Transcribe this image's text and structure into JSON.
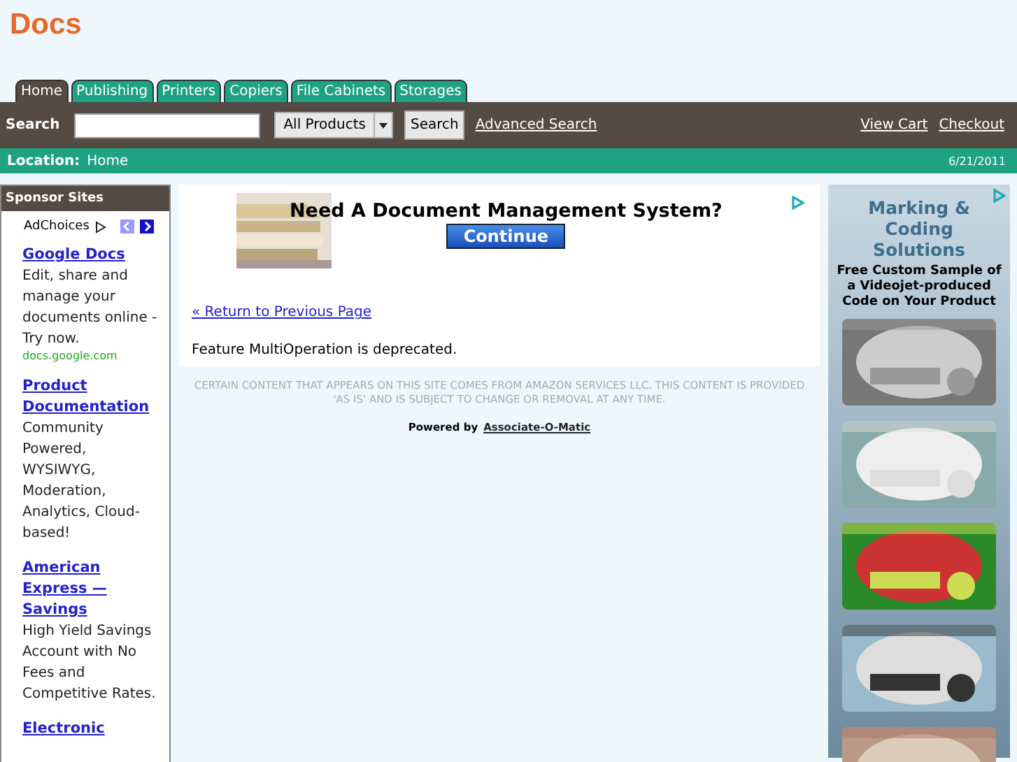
{
  "site_title": "Docs",
  "tabs": [
    {
      "label": "Home",
      "selected": true
    },
    {
      "label": "Publishing",
      "selected": false
    },
    {
      "label": "Printers",
      "selected": false
    },
    {
      "label": "Copiers",
      "selected": false
    },
    {
      "label": "File Cabinets",
      "selected": false
    },
    {
      "label": "Storages",
      "selected": false
    }
  ],
  "search_bar": {
    "label": "Search",
    "category": "All Products",
    "button": "Search",
    "advanced_link": "Advanced Search",
    "links": [
      "View Cart",
      "Checkout"
    ]
  },
  "location_bar": {
    "label": "Location:",
    "value": "Home",
    "date": "6/21/2011"
  },
  "sponsor_sidebar": {
    "title": "Sponsor Sites",
    "adchoices": "AdChoices",
    "ads": [
      {
        "title": "Google Docs",
        "text": "Edit, share and manage your documents online - Try now.",
        "url": "docs.google.com"
      },
      {
        "title": "Product Documentation",
        "text": "Community Powered, WYSIWYG, Moderation, Analytics, Cloud-based!"
      },
      {
        "title": "American Express —Savings",
        "text": "High Yield Savings Account with No Fees and Competitive Rates."
      },
      {
        "title": "Electronic"
      }
    ]
  },
  "main": {
    "banner": {
      "headline": "Need A Document Management System?",
      "button": "Continue"
    },
    "back_link": "« Return to Previous Page",
    "message": "Feature MultiOperation is deprecated.",
    "disclaimer": "CERTAIN CONTENT THAT APPEARS ON THIS SITE COMES FROM AMAZON SERVICES LLC. THIS CONTENT IS PROVIDED 'AS IS' AND IS SUBJECT TO CHANGE OR REMOVAL AT ANY TIME.",
    "powered_by": "Powered by",
    "powered_link": "Associate-O-Matic"
  },
  "side_banner": {
    "headline": "Marking & Coding Solutions",
    "subline": "Free Custom Sample of a Videojet-produced Code on Your Product"
  }
}
